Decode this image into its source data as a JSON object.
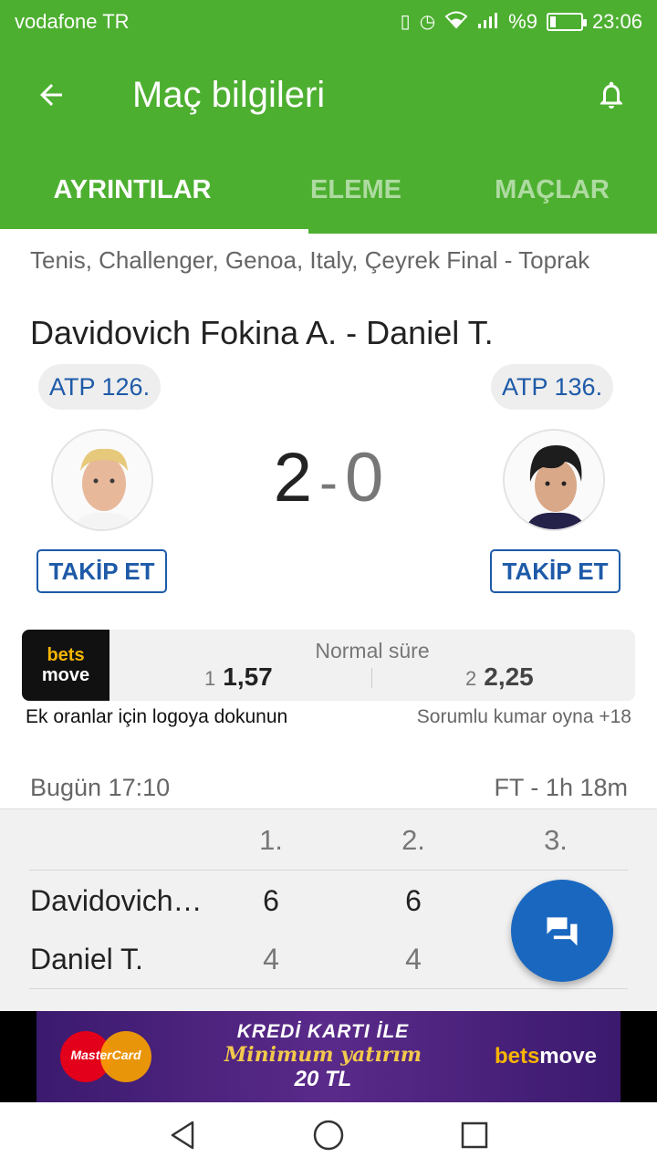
{
  "status_bar": {
    "carrier": "vodafone TR",
    "battery": "%9",
    "time": "23:06"
  },
  "app_bar": {
    "title": "Maç bilgileri"
  },
  "tabs": [
    {
      "label": "AYRINTILAR",
      "active": true
    },
    {
      "label": "ELEME",
      "active": false
    },
    {
      "label": "MAÇLAR",
      "active": false
    }
  ],
  "match": {
    "breadcrumb": "Tenis, Challenger, Genoa, Italy, Çeyrek Final - Toprak",
    "title": "Davidovich Fokina A. - Daniel T.",
    "home": {
      "rank": "ATP 126.",
      "follow_label": "TAKİP ET",
      "score": "2"
    },
    "away": {
      "rank": "ATP 136.",
      "follow_label": "TAKİP ET",
      "score": "0"
    },
    "score_separator": "-"
  },
  "odds": {
    "logo_line1": "bets",
    "logo_line2": "move",
    "label": "Normal süre",
    "home_index": "1",
    "home_value": "1,57",
    "away_index": "2",
    "away_value": "2,25",
    "hint": "Ek oranlar için logoya dokunun",
    "responsible": "Sorumlu kumar oyna +18"
  },
  "info": {
    "date": "Bugün 17:10",
    "duration": "FT - 1h 18m"
  },
  "score_table": {
    "headers": [
      "1.",
      "2.",
      "3."
    ],
    "rows": [
      {
        "name": "Davidovich…",
        "sets": [
          "6",
          "6"
        ]
      },
      {
        "name": "Daniel T.",
        "sets": [
          "4",
          "4"
        ]
      }
    ]
  },
  "ad": {
    "card_brand": "MasterCard",
    "line1": "KREDİ KARTI İLE",
    "line2": "Minimum yatırım",
    "line3": "20 TL",
    "brand_part1": "bets",
    "brand_part2": "move"
  },
  "colors": {
    "primary_green": "#4daf30",
    "accent_blue": "#1e5aa8",
    "fab_blue": "#1a67c0"
  },
  "icons": {
    "back": "arrow-left-icon",
    "bell": "bell-icon",
    "fab": "chat-icon"
  }
}
